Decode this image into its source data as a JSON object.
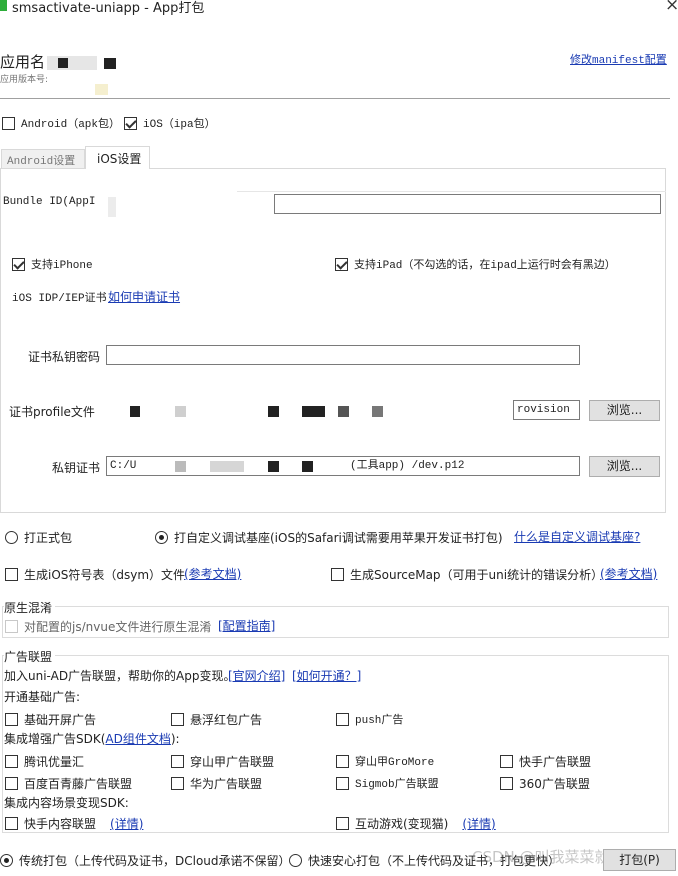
{
  "window": {
    "title": "smsactivate-uniapp - App打包",
    "close_glyph": "×"
  },
  "header": {
    "app_name_label": "应用名",
    "app_version_label": "应用版本号:",
    "modify_manifest_link": "修改manifest配置"
  },
  "platforms": {
    "android": {
      "label": "Android（apk包）",
      "checked": false
    },
    "ios": {
      "label": "iOS（ipa包）",
      "checked": true
    }
  },
  "tabs": [
    {
      "label": "Android设置",
      "active": false
    },
    {
      "label": "iOS设置",
      "active": true
    }
  ],
  "ios_settings": {
    "bundle_id_label": "Bundle ID(AppI",
    "support_iphone": {
      "label": "支持iPhone",
      "checked": true
    },
    "support_ipad": {
      "label": "支持iPad（不勾选的话，在ipad上运行时会有黑边）",
      "checked": true
    },
    "cert_type_label": "iOS IDP/IEP证书",
    "apply_cert_link": "如何申请证书",
    "private_key_password_label": "证书私钥密码",
    "private_key_password_value": "",
    "profile_label": "证书profile文件",
    "profile_value_suffix": "rovision",
    "browse_label": "浏览...",
    "private_key_cert_label": "私钥证书",
    "private_key_cert_prefix": "C:/U",
    "private_key_cert_suffix": "(工具app) /dev.p12"
  },
  "build_type": {
    "formal": {
      "label": "打正式包",
      "checked": false
    },
    "custom_base": {
      "label": "打自定义调试基座(iOS的Safari调试需要用苹果开发证书打包)",
      "checked": true
    },
    "custom_base_link": "什么是自定义调试基座?"
  },
  "options": {
    "dsym": {
      "label": "生成iOS符号表（dsym）文件",
      "checked": false,
      "doc_link": "(参考文档)"
    },
    "sourcemap": {
      "label": "生成SourceMap（可用于uni统计的错误分析）",
      "checked": false,
      "doc_link": "(参考文档)"
    }
  },
  "obfuscation": {
    "title": "原生混淆",
    "checkbox_label": "对配置的js/nvue文件进行原生混淆",
    "guide_link": "[配置指南]"
  },
  "ads": {
    "title": "广告联盟",
    "intro": "加入uni-AD广告联盟，帮助你的App变现。",
    "official_link": "[官网介绍]",
    "how_link": "[如何开通？]",
    "basic_title": "开通基础广告:",
    "basic_items": [
      "基础开屏广告",
      "悬浮红包广告",
      "push广告"
    ],
    "enhanced_title_prefix": "集成增强广告SDK(",
    "enhanced_doc_link": "AD组件文档",
    "enhanced_title_suffix": "):",
    "enhanced_row1": [
      "腾讯优量汇",
      "穿山甲广告联盟",
      "穿山甲GroMore",
      "快手广告联盟"
    ],
    "enhanced_row2": [
      "百度百青藤广告联盟",
      "华为广告联盟",
      "Sigmob广告联盟",
      "360广告联盟"
    ],
    "content_title": "集成内容场景变现SDK:",
    "content_items": [
      {
        "label": "快手内容联盟",
        "link": "(详情)"
      },
      {
        "label": "互动游戏(变现猫)",
        "link": "(详情)"
      }
    ]
  },
  "footer": {
    "traditional": {
      "label": "传统打包（上传代码及证书，DCloud承诺不保留）",
      "checked": true
    },
    "fast": {
      "label": "快速安心打包（不上传代码及证书，打包更快）",
      "checked": false
    },
    "watermark": "CSDN @叫我菜菜就好",
    "pack_button": "打包(P)"
  }
}
